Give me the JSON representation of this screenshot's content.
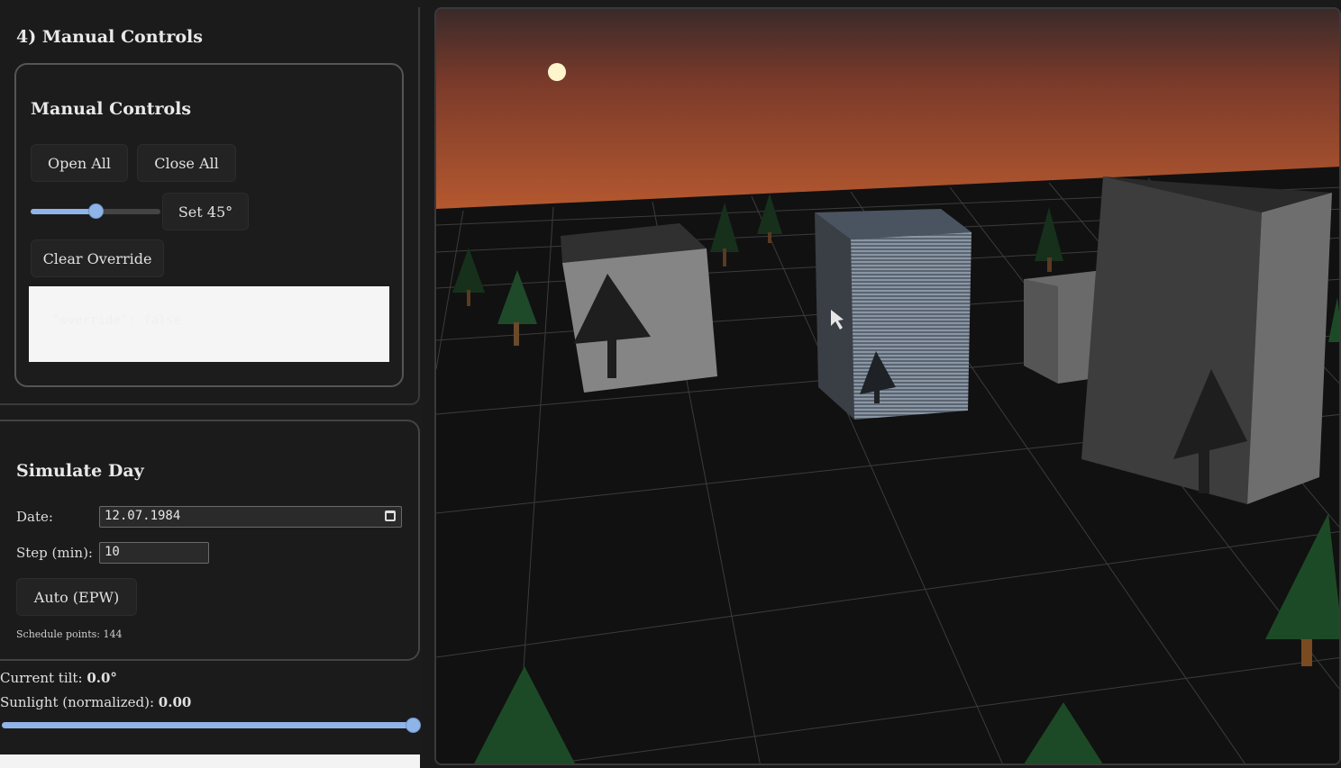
{
  "section": {
    "title": "4) Manual Controls"
  },
  "manual": {
    "title": "Manual Controls",
    "open_all": "Open All",
    "close_all": "Close All",
    "slider_value": 0.5,
    "set_label": "Set 45°",
    "clear_override": "Clear Override",
    "output_text": "\"override\": false"
  },
  "simulate": {
    "title": "Simulate Day",
    "date_label": "Date:",
    "date_value": "12.07.1984",
    "step_label": "Step (min):",
    "step_value": "10",
    "auto_button": "Auto (EPW)",
    "schedule_text": "Schedule points: 144"
  },
  "status": {
    "tilt_label": "Current tilt:",
    "tilt_value": "0.0°",
    "sun_label": "Sunlight (normalized):",
    "sun_value": "0.00",
    "sun_slider_value": 1.0
  },
  "colors": {
    "accent": "#8fb4e8",
    "sky_top": "#3a2a2a",
    "sky_horizon": "#b85a30"
  }
}
